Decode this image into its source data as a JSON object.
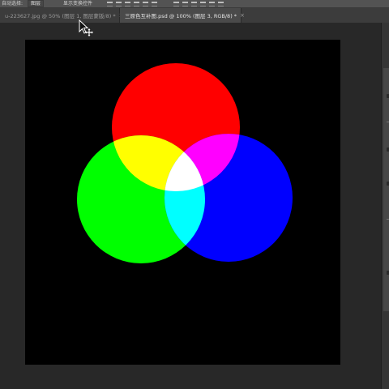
{
  "options_bar": {
    "auto_select_label": "自动选择:",
    "layer_select_value": "图层",
    "show_transform_label": "显示变换控件"
  },
  "tabs": [
    {
      "label": "u-223627.jpg @ 50% (图层 1, 图层蒙版/8) *",
      "active": false
    },
    {
      "label": "三原色互补图.psd @ 100% (图层 3, RGB/8) *",
      "active": true
    }
  ],
  "canvas": {
    "background": "#000000",
    "circles": [
      {
        "name": "red",
        "color": "#ff0000"
      },
      {
        "name": "green",
        "color": "#00ff00"
      },
      {
        "name": "blue",
        "color": "#0000ff"
      }
    ],
    "overlaps": {
      "red_green": "#ffff00",
      "red_blue": "#ff00ff",
      "green_blue": "#00ffff",
      "all": "#ffffff"
    }
  },
  "icons": {
    "tab_close": "×",
    "cursor": "arrow-move-cursor-icon"
  }
}
